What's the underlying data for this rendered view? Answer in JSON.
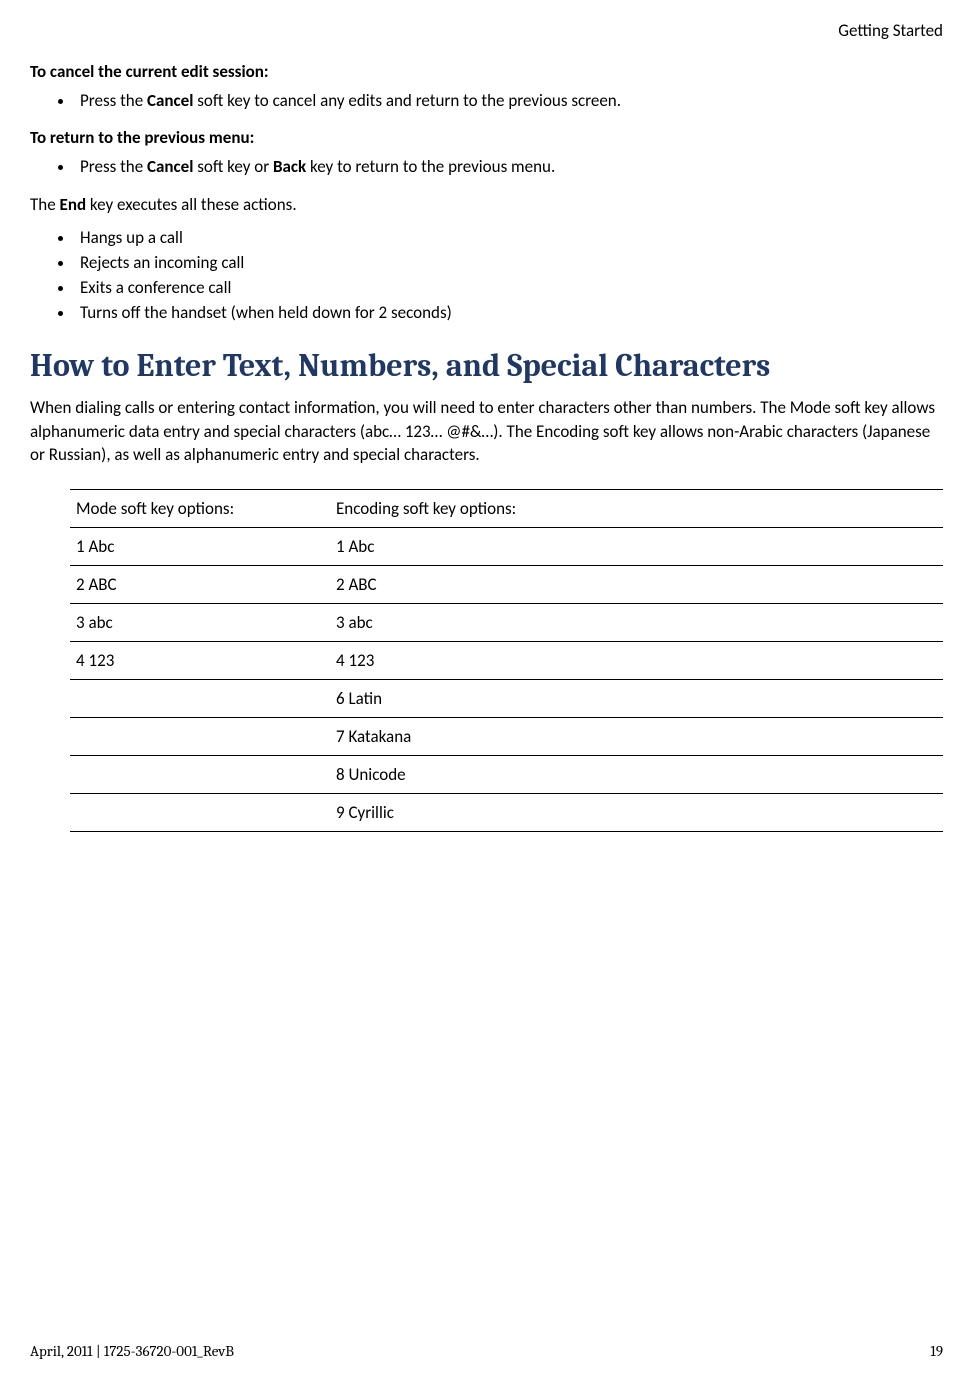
{
  "header": {
    "section": "Getting Started"
  },
  "cancel_session": {
    "heading": "To cancel the current edit session:",
    "bullet_prefix": "Press the ",
    "bullet_key": "Cancel",
    "bullet_suffix": " soft key to cancel any edits and return to the previous screen."
  },
  "return_menu": {
    "heading": "To return to the previous menu:",
    "bullet_prefix": "Press the ",
    "bullet_key1": "Cancel",
    "bullet_mid": " soft key or ",
    "bullet_key2": "Back",
    "bullet_suffix": " key to return to the previous menu."
  },
  "end_key": {
    "intro_prefix": "The ",
    "intro_key": "End",
    "intro_suffix": " key executes all these actions.",
    "items": [
      "Hangs up a call",
      "Rejects an incoming call",
      "Exits a conference call",
      "Turns off the handset (when held down for 2 seconds)"
    ]
  },
  "section": {
    "title": "How to Enter Text, Numbers, and Special Characters",
    "paragraph": "When dialing calls or entering contact information, you will need to enter characters other than numbers. The Mode soft key allows alphanumeric data entry and special characters (abc… 123… @#&…). The Encoding soft key allows non-Arabic characters (Japanese or Russian), as well as alphanumeric entry and special characters."
  },
  "table": {
    "col1_header": "Mode soft key options:",
    "col2_header": "Encoding soft key options:",
    "rows": [
      {
        "c1": "1 Abc",
        "c2": "1 Abc"
      },
      {
        "c1": "2 ABC",
        "c2": "2 ABC"
      },
      {
        "c1": "3 abc",
        "c2": "3 abc"
      },
      {
        "c1": "4 123",
        "c2": "4 123"
      },
      {
        "c1": "",
        "c2": "6 Latin"
      },
      {
        "c1": "",
        "c2": "7 Katakana"
      },
      {
        "c1": "",
        "c2": "8 Unicode"
      },
      {
        "c1": "",
        "c2": "9 Cyrillic"
      }
    ]
  },
  "footer": {
    "left": "April, 2011  |  1725-36720-001_RevB",
    "right": "19"
  }
}
